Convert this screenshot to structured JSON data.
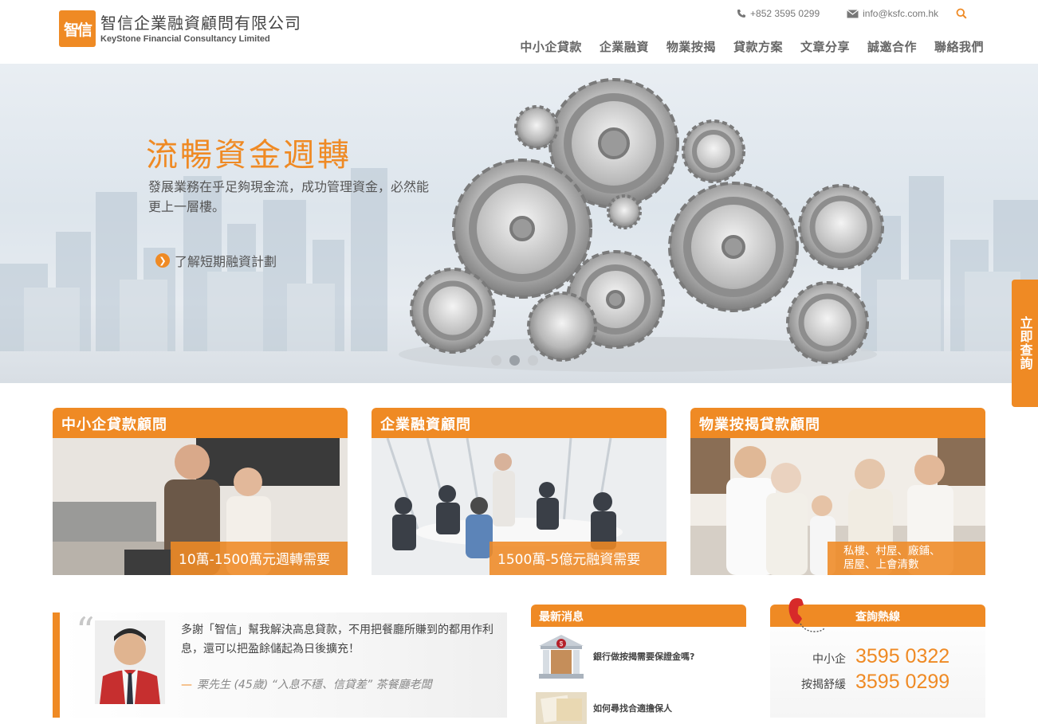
{
  "header": {
    "logo_mark": "智信",
    "company_zh": "智信企業融資顧問有限公司",
    "company_en": "KeyStone Financial Consultancy Limited",
    "phone": "+852 3595 0299",
    "email": "info@ksfc.com.hk",
    "nav": [
      "中小企貸款",
      "企業融資",
      "物業按揭",
      "貸款方案",
      "文章分享",
      "誠邀合作",
      "聯絡我們"
    ]
  },
  "hero": {
    "title": "流暢資金週轉",
    "subtitle": "發展業務在乎足夠現金流，成功管理資金，必然能更上一層樓。",
    "link": "了解短期融資計劃",
    "slides_total": 3,
    "slide_active": 2
  },
  "side_tab": {
    "label": "立即查詢"
  },
  "cards": [
    {
      "title": "中小企貸款顧問",
      "caption": "10萬-1500萬元週轉需要"
    },
    {
      "title": "企業融資顧問",
      "caption": "1500萬-5億元融資需要"
    },
    {
      "title": "物業按揭貸款顧問",
      "caption_line1": "私樓、村屋、廠鋪、",
      "caption_line2": "居屋、上會清數"
    }
  ],
  "testimonial": {
    "text": "多謝「智信」幫我解決高息貸款，不用把餐廳所賺到的都用作利息，還可以把盈餘儲起為日後擴充！",
    "author": "栗先生 (45歲) “入息不穩、信貸差” 茶餐廳老闆"
  },
  "news": {
    "heading": "最新消息",
    "items": [
      "銀行做按揭需要保證金嗎?",
      "如何尋找合適擔保人"
    ]
  },
  "hotline": {
    "heading": "查詢熱線",
    "rows": [
      {
        "label": "中小企",
        "number": "3595 0322"
      },
      {
        "label": "按揭舒緩",
        "number": "3595 0299"
      }
    ]
  },
  "colors": {
    "brand_orange": "#ef8a24"
  }
}
